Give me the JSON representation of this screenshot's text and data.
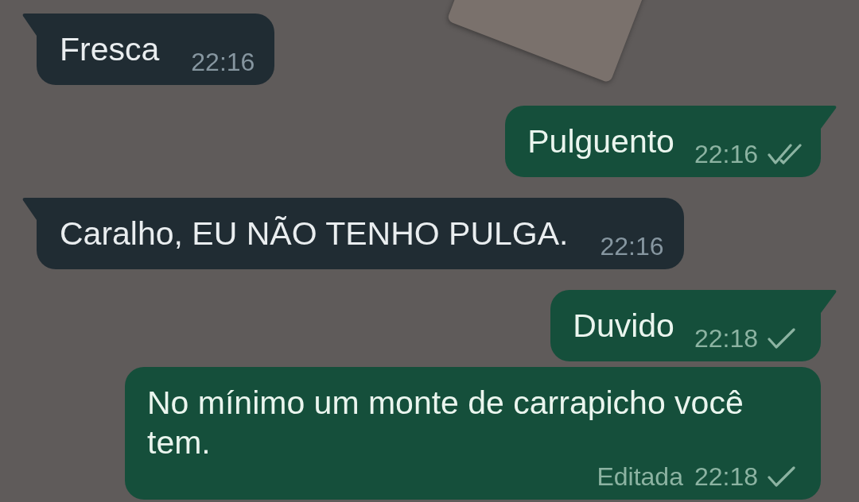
{
  "messages": [
    {
      "kind": "incoming",
      "tail": true,
      "text": "Fresca",
      "time": "22:16"
    },
    {
      "kind": "outgoing",
      "tail": true,
      "text": "Pulguento",
      "time": "22:16",
      "delivered": true
    },
    {
      "kind": "incoming",
      "tail": true,
      "text": "Caralho, EU NÃO TENHO PULGA.",
      "time": "22:16"
    },
    {
      "kind": "outgoing",
      "tail": true,
      "text": "Duvido",
      "time": "22:18",
      "delivered": false
    },
    {
      "kind": "outgoing",
      "tail": false,
      "text": "No mínimo um monte de carrapicho você tem.",
      "time": "22:18",
      "delivered": false,
      "edited_label": "Editada"
    }
  ]
}
